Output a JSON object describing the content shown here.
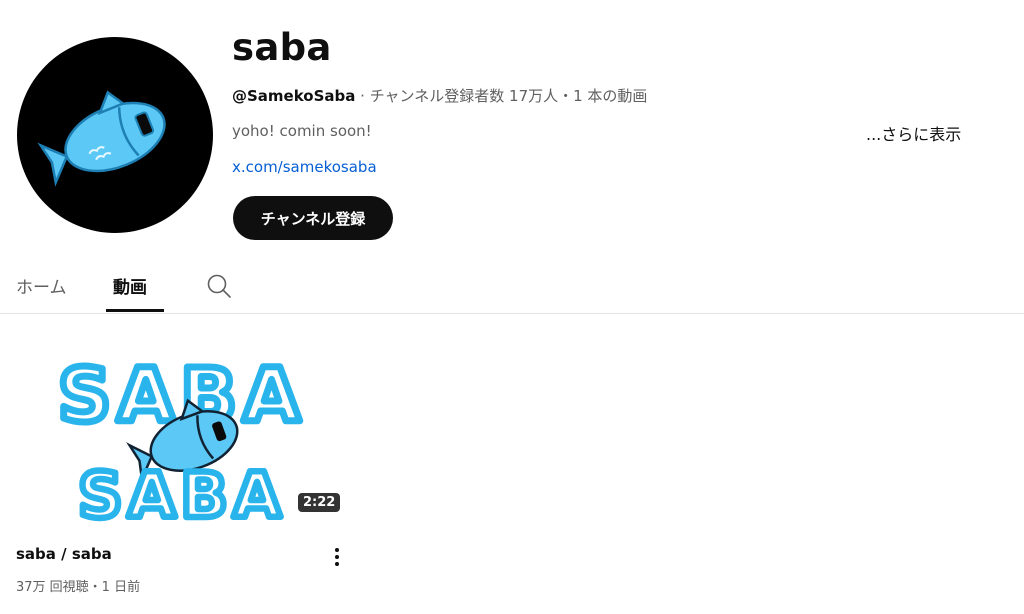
{
  "channel": {
    "name": "saba",
    "handle": "@SamekoSaba",
    "stats": " · チャンネル登録者数 17万人・1 本の動画",
    "description": "yoho! comin soon!",
    "more_label": "...さらに表示",
    "link": "x.com/samekosaba",
    "subscribe_label": "チャンネル登録"
  },
  "tabs": [
    {
      "label": "ホーム",
      "active": false
    },
    {
      "label": "動画",
      "active": true
    }
  ],
  "icons": {
    "tab_search": "search-icon",
    "video_menu": "more-vert-icon"
  },
  "video": {
    "thumbnail_text_top": "SABA",
    "thumbnail_text_bottom": "SABA",
    "duration": "2:22",
    "title": "saba / saba",
    "meta": "37万 回視聴・1 日前"
  },
  "colors": {
    "accent_link": "#065fd4",
    "fish": "#4fc3f7",
    "subscribe_bg": "#0f0f0f"
  }
}
